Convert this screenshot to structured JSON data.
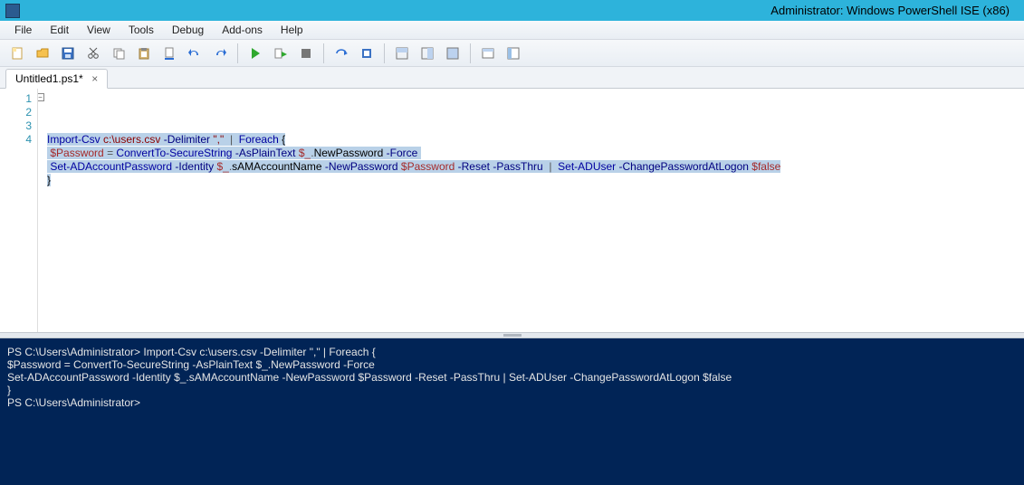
{
  "window": {
    "title": "Administrator: Windows PowerShell ISE (x86)"
  },
  "menubar": {
    "items": [
      "File",
      "Edit",
      "View",
      "Tools",
      "Debug",
      "Add-ons",
      "Help"
    ]
  },
  "toolbar": {
    "icons": [
      "new-file-icon",
      "open-file-icon",
      "save-icon",
      "cut-icon",
      "copy-icon",
      "paste-icon",
      "clear-icon",
      "undo-icon",
      "redo-icon",
      "sep",
      "run-icon",
      "run-selection-icon",
      "stop-icon",
      "sep",
      "step-over-icon",
      "toggle-breakpoint-icon",
      "sep",
      "show-script-pane-icon",
      "show-script-right-icon",
      "show-script-max-icon",
      "sep",
      "show-command-addon-icon",
      "show-commands-icon"
    ]
  },
  "tabs": [
    {
      "label": "Untitled1.ps1*",
      "close": "×"
    }
  ],
  "editor": {
    "line_numbers": [
      "1",
      "2",
      "3",
      "4"
    ],
    "collapse_marker": "−",
    "lines": {
      "l1": [
        {
          "cls": "t-cmd sel",
          "txt": "Import-Csv"
        },
        {
          "cls": "sel",
          "txt": " "
        },
        {
          "cls": "t-str sel",
          "txt": "c:\\users.csv"
        },
        {
          "cls": "sel",
          "txt": " "
        },
        {
          "cls": "t-param sel",
          "txt": "-Delimiter"
        },
        {
          "cls": "sel",
          "txt": " "
        },
        {
          "cls": "t-str sel",
          "txt": "\",\""
        },
        {
          "cls": "sel",
          "txt": "  "
        },
        {
          "cls": "t-op sel",
          "txt": "|"
        },
        {
          "cls": "sel",
          "txt": "  "
        },
        {
          "cls": "t-cmd sel",
          "txt": "Foreach"
        },
        {
          "cls": "sel",
          "txt": " "
        },
        {
          "cls": "t-brace sel",
          "txt": "{"
        }
      ],
      "l2": [
        {
          "cls": "sel",
          "txt": " "
        },
        {
          "cls": "t-var sel",
          "txt": "$Password"
        },
        {
          "cls": "sel",
          "txt": " "
        },
        {
          "cls": "t-op sel",
          "txt": "="
        },
        {
          "cls": "sel",
          "txt": " "
        },
        {
          "cls": "t-cmd sel",
          "txt": "ConvertTo-SecureString"
        },
        {
          "cls": "sel",
          "txt": " "
        },
        {
          "cls": "t-param sel",
          "txt": "-AsPlainText"
        },
        {
          "cls": "sel",
          "txt": " "
        },
        {
          "cls": "t-var sel",
          "txt": "$_"
        },
        {
          "cls": "t-op sel",
          "txt": "."
        },
        {
          "cls": "t-prop sel",
          "txt": "NewPassword"
        },
        {
          "cls": "sel",
          "txt": " "
        },
        {
          "cls": "t-param sel",
          "txt": "-Force"
        },
        {
          "cls": "sel",
          "txt": " "
        }
      ],
      "l3": [
        {
          "cls": "sel",
          "txt": " "
        },
        {
          "cls": "t-cmd sel",
          "txt": "Set-ADAccountPassword"
        },
        {
          "cls": "sel",
          "txt": " "
        },
        {
          "cls": "t-param sel",
          "txt": "-Identity"
        },
        {
          "cls": "sel",
          "txt": " "
        },
        {
          "cls": "t-var sel",
          "txt": "$_"
        },
        {
          "cls": "t-op sel",
          "txt": "."
        },
        {
          "cls": "t-prop sel",
          "txt": "sAMAccountName"
        },
        {
          "cls": "sel",
          "txt": " "
        },
        {
          "cls": "t-param sel",
          "txt": "-NewPassword"
        },
        {
          "cls": "sel",
          "txt": " "
        },
        {
          "cls": "t-var sel",
          "txt": "$Password"
        },
        {
          "cls": "sel",
          "txt": " "
        },
        {
          "cls": "t-param sel",
          "txt": "-Reset"
        },
        {
          "cls": "sel",
          "txt": " "
        },
        {
          "cls": "t-param sel",
          "txt": "-PassThru"
        },
        {
          "cls": "sel",
          "txt": "  "
        },
        {
          "cls": "t-op sel",
          "txt": "|"
        },
        {
          "cls": "sel",
          "txt": "  "
        },
        {
          "cls": "t-cmd sel",
          "txt": "Set-ADUser"
        },
        {
          "cls": "sel",
          "txt": " "
        },
        {
          "cls": "t-param sel",
          "txt": "-ChangePasswordAtLogon"
        },
        {
          "cls": "sel",
          "txt": " "
        },
        {
          "cls": "t-bool sel",
          "txt": "$false"
        }
      ],
      "l4": [
        {
          "cls": "t-brace sel",
          "txt": "}"
        }
      ]
    }
  },
  "console": {
    "lines": [
      "PS C:\\Users\\Administrator> Import-Csv c:\\users.csv -Delimiter \",\" | Foreach {",
      "$Password = ConvertTo-SecureString -AsPlainText $_.NewPassword -Force",
      "Set-ADAccountPassword -Identity $_.sAMAccountName -NewPassword $Password -Reset -PassThru | Set-ADUser -ChangePasswordAtLogon $false",
      "}",
      "",
      "PS C:\\Users\\Administrator>"
    ]
  }
}
